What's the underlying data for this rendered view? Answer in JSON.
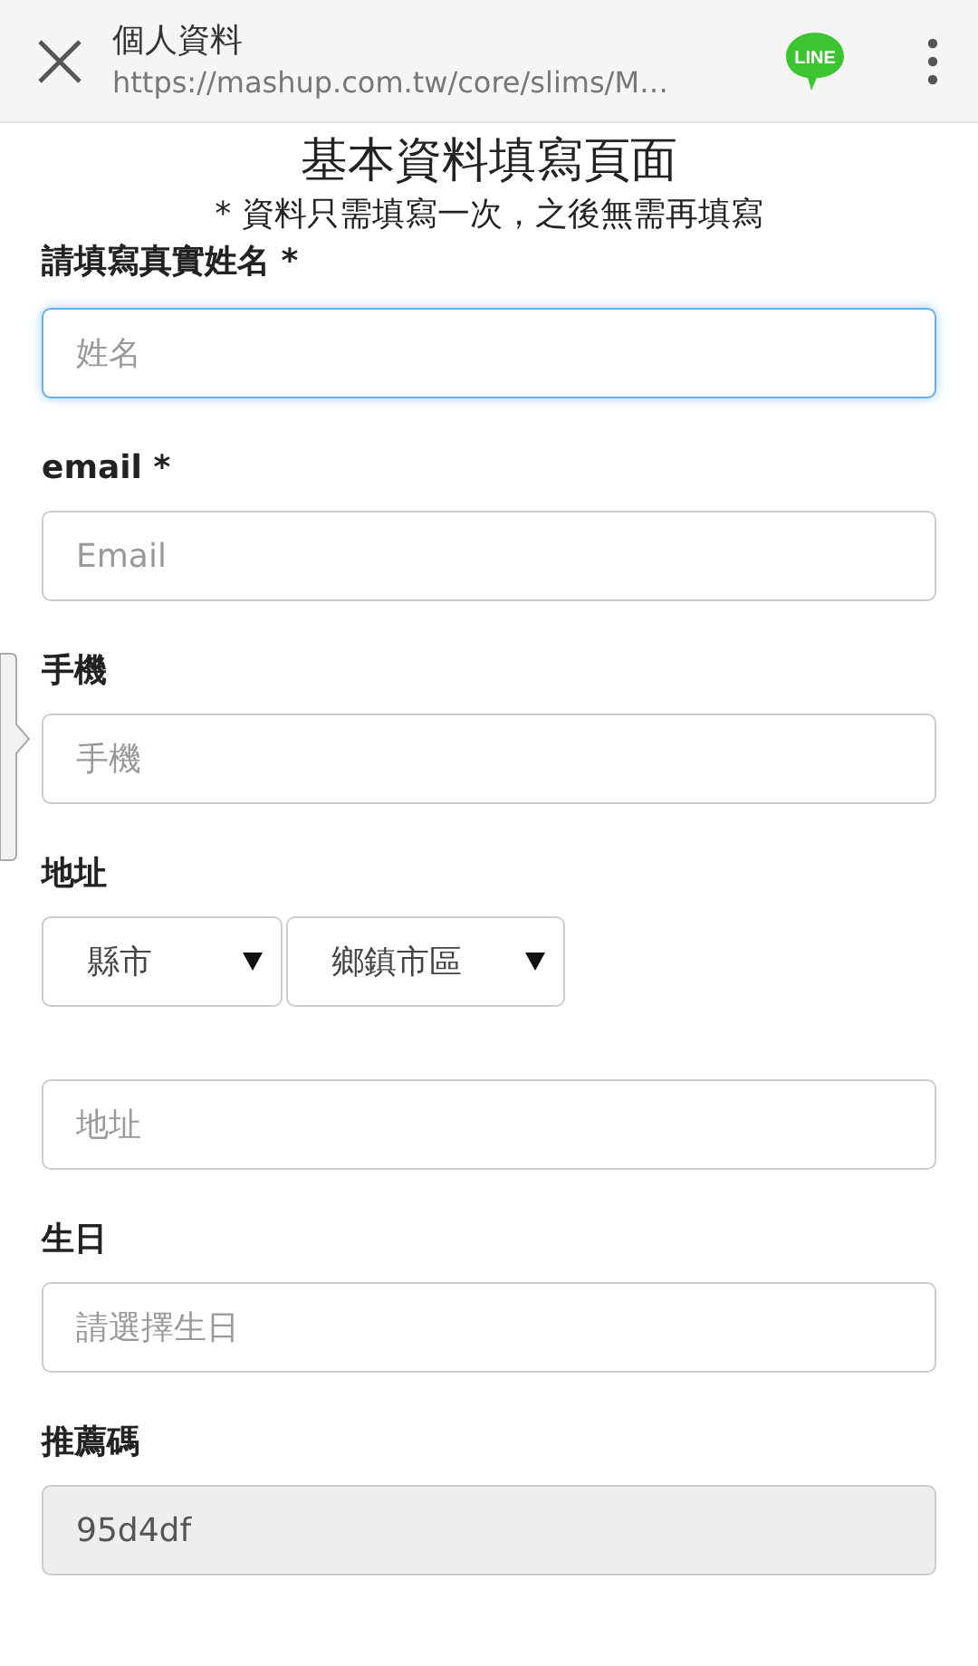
{
  "app_bar": {
    "title": "個人資料",
    "url": "https://mashup.com.tw/core/slims/M…",
    "share_badge": "LINE"
  },
  "heading": "基本資料填寫頁面",
  "note": "* 資料只需填寫一次，之後無需再填寫",
  "fields": [
    {
      "kind": "text",
      "label": "請填寫真實姓名 *",
      "placeholder": "姓名",
      "focused": true
    },
    {
      "kind": "text",
      "label": "email *",
      "placeholder": "Email",
      "focused": false
    },
    {
      "kind": "text",
      "label": "手機",
      "placeholder": "手機",
      "focused": false
    },
    {
      "kind": "address",
      "label": "地址",
      "selects": [
        {
          "label": "縣市"
        },
        {
          "label": "鄉鎮市區"
        }
      ],
      "placeholder": "地址"
    },
    {
      "kind": "text",
      "label": "生日",
      "placeholder": "請選擇生日",
      "focused": false
    },
    {
      "kind": "readonly",
      "label": "推薦碼",
      "value": "95d4df"
    }
  ]
}
